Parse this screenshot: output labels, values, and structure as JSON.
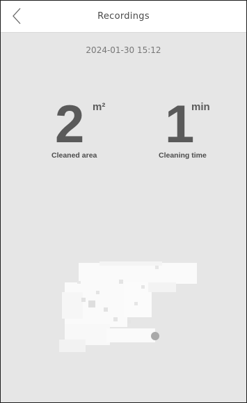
{
  "header": {
    "title": "Recordings",
    "back_icon": "chevron-left-icon"
  },
  "record": {
    "datetime": "2024-01-30 15:12"
  },
  "stats": {
    "area": {
      "value": "2",
      "unit": "m²",
      "label": "Cleaned area"
    },
    "time": {
      "value": "1",
      "unit": "min",
      "label": "Cleaning time"
    }
  },
  "map": {
    "floor_color": "#ffffff",
    "robot_color": "#a9a9a9",
    "robot_icon": "robot-position-icon"
  }
}
